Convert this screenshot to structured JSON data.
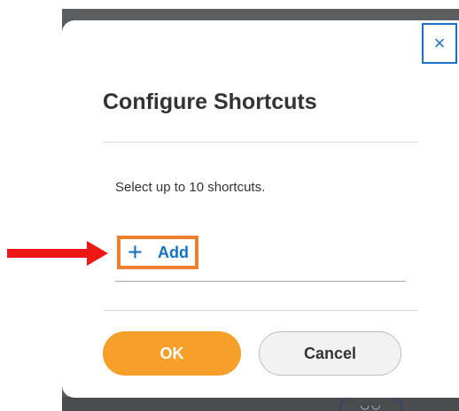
{
  "dialog": {
    "title": "Configure Shortcuts",
    "instruction": "Select up to 10 shortcuts.",
    "close_symbol": "×",
    "close_icon": "close-icon",
    "add_symbol": "+",
    "add_icon": "plus-icon",
    "add_label": "Add",
    "ok_label": "OK",
    "cancel_label": "Cancel"
  },
  "annotations": {
    "arrow_color": "#f01717",
    "highlight_color": "#ef7f2f"
  },
  "colors": {
    "accent": "#0f72c7",
    "ok_button": "#f6a02b",
    "backdrop": "#5d5e60"
  }
}
